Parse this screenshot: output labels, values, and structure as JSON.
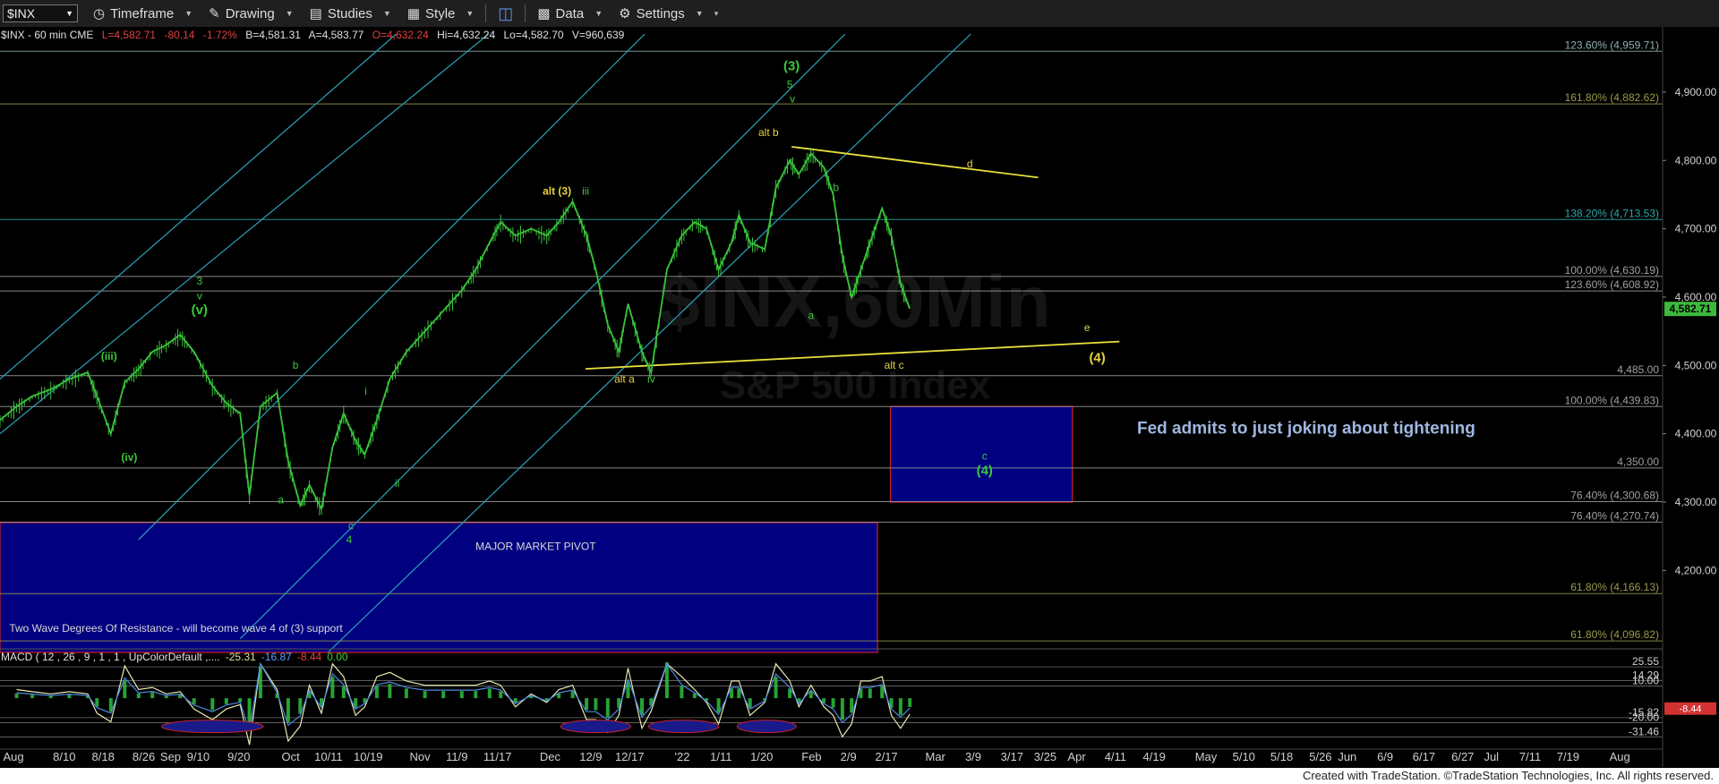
{
  "toolbar": {
    "symbol": "$INX",
    "timeframe": "Timeframe",
    "drawing": "Drawing",
    "studies": "Studies",
    "style": "Style",
    "data": "Data",
    "settings": "Settings"
  },
  "header": {
    "info": "$INX - 60 min  CME",
    "last": "L=4,582.71",
    "change": "-80.14",
    "pct": "-1.72%",
    "bid": "B=4,581.31",
    "ask": "A=4,583.77",
    "open": "O=4,632.24",
    "high": "Hi=4,632.24",
    "low": "Lo=4,582.70",
    "volume": "V=960,639"
  },
  "watermark": {
    "symbol": "$INX,60Min",
    "name": "S&P 500 Index"
  },
  "chart_data": {
    "type": "line",
    "title": "$INX - 60 min",
    "ylim": [
      4080,
      4985
    ],
    "price_ticks": [
      4200,
      4300,
      4400,
      4500,
      4600,
      4700,
      4800,
      4900
    ],
    "price_tick_labels": [
      "4,200.00",
      "4,300.00",
      "4,400.00",
      "4,500.00",
      "4,600.00",
      "4,700.00",
      "4,800.00",
      "4,900.00"
    ],
    "last_price": {
      "value": 4582.71,
      "label": "4,582.71",
      "color": "#3cb93c"
    },
    "x_ticks": [
      {
        "t": 0.03,
        "label": "Aug"
      },
      {
        "t": 0.58,
        "label": "8/10"
      },
      {
        "t": 1.0,
        "label": "8/18"
      },
      {
        "t": 1.44,
        "label": "8/26"
      },
      {
        "t": 1.73,
        "label": "Sep"
      },
      {
        "t": 2.03,
        "label": "9/10"
      },
      {
        "t": 2.47,
        "label": "9/20"
      },
      {
        "t": 3.03,
        "label": "Oct"
      },
      {
        "t": 3.44,
        "label": "10/11"
      },
      {
        "t": 3.87,
        "label": "10/19"
      },
      {
        "t": 4.43,
        "label": "Nov"
      },
      {
        "t": 4.83,
        "label": "11/9"
      },
      {
        "t": 5.27,
        "label": "11/17"
      },
      {
        "t": 5.84,
        "label": "Dec"
      },
      {
        "t": 6.28,
        "label": "12/9"
      },
      {
        "t": 6.7,
        "label": "12/17"
      },
      {
        "t": 7.27,
        "label": "'22"
      },
      {
        "t": 7.69,
        "label": "1/11"
      },
      {
        "t": 8.13,
        "label": "1/20"
      },
      {
        "t": 8.67,
        "label": "Feb"
      },
      {
        "t": 9.07,
        "label": "2/9"
      },
      {
        "t": 9.48,
        "label": "2/17"
      },
      {
        "t": 10.01,
        "label": "Mar"
      },
      {
        "t": 10.42,
        "label": "3/9"
      },
      {
        "t": 10.84,
        "label": "3/17"
      },
      {
        "t": 11.2,
        "label": "3/25"
      },
      {
        "t": 11.54,
        "label": "Apr"
      },
      {
        "t": 11.96,
        "label": "4/11"
      },
      {
        "t": 12.38,
        "label": "4/19"
      },
      {
        "t": 12.94,
        "label": "May"
      },
      {
        "t": 13.35,
        "label": "5/10"
      },
      {
        "t": 13.76,
        "label": "5/18"
      },
      {
        "t": 14.18,
        "label": "5/26"
      },
      {
        "t": 14.47,
        "label": "Jun"
      },
      {
        "t": 14.88,
        "label": "6/9"
      },
      {
        "t": 15.3,
        "label": "6/17"
      },
      {
        "t": 15.72,
        "label": "6/27"
      },
      {
        "t": 16.03,
        "label": "Jul"
      },
      {
        "t": 16.45,
        "label": "7/11"
      },
      {
        "t": 16.86,
        "label": "7/19"
      },
      {
        "t": 17.42,
        "label": "Aug"
      }
    ],
    "price_series": {
      "color": "#39c43a",
      "points": [
        [
          0.0,
          4420
        ],
        [
          0.18,
          4440
        ],
        [
          0.35,
          4455
        ],
        [
          0.55,
          4465
        ],
        [
          0.75,
          4480
        ],
        [
          0.95,
          4490
        ],
        [
          1.05,
          4455
        ],
        [
          1.2,
          4400
        ],
        [
          1.35,
          4475
        ],
        [
          1.5,
          4495
        ],
        [
          1.65,
          4520
        ],
        [
          1.8,
          4530
        ],
        [
          1.95,
          4545
        ],
        [
          2.1,
          4520
        ],
        [
          2.3,
          4470
        ],
        [
          2.45,
          4445
        ],
        [
          2.6,
          4430
        ],
        [
          2.7,
          4310
        ],
        [
          2.82,
          4440
        ],
        [
          3.0,
          4460
        ],
        [
          3.12,
          4360
        ],
        [
          3.25,
          4295
        ],
        [
          3.35,
          4325
        ],
        [
          3.48,
          4290
        ],
        [
          3.6,
          4380
        ],
        [
          3.72,
          4430
        ],
        [
          3.85,
          4390
        ],
        [
          3.95,
          4370
        ],
        [
          4.08,
          4420
        ],
        [
          4.22,
          4480
        ],
        [
          4.4,
          4520
        ],
        [
          4.6,
          4550
        ],
        [
          4.8,
          4580
        ],
        [
          5.0,
          4610
        ],
        [
          5.15,
          4640
        ],
        [
          5.3,
          4680
        ],
        [
          5.42,
          4710
        ],
        [
          5.58,
          4690
        ],
        [
          5.75,
          4700
        ],
        [
          5.92,
          4690
        ],
        [
          6.05,
          4710
        ],
        [
          6.2,
          4740
        ],
        [
          6.35,
          4690
        ],
        [
          6.45,
          4640
        ],
        [
          6.58,
          4560
        ],
        [
          6.7,
          4520
        ],
        [
          6.8,
          4590
        ],
        [
          6.95,
          4520
        ],
        [
          7.05,
          4490
        ],
        [
          7.22,
          4640
        ],
        [
          7.38,
          4690
        ],
        [
          7.52,
          4710
        ],
        [
          7.65,
          4700
        ],
        [
          7.78,
          4640
        ],
        [
          7.92,
          4680
        ],
        [
          8.0,
          4720
        ],
        [
          8.12,
          4680
        ],
        [
          8.28,
          4670
        ],
        [
          8.4,
          4760
        ],
        [
          8.55,
          4800
        ],
        [
          8.65,
          4780
        ],
        [
          8.78,
          4810
        ],
        [
          8.92,
          4790
        ],
        [
          9.02,
          4750
        ],
        [
          9.12,
          4660
        ],
        [
          9.22,
          4600
        ],
        [
          9.32,
          4640
        ],
        [
          9.42,
          4680
        ],
        [
          9.55,
          4730
        ],
        [
          9.65,
          4690
        ],
        [
          9.75,
          4620
        ],
        [
          9.85,
          4583
        ]
      ]
    },
    "horizontal_levels": [
      {
        "price": 4959.71,
        "label": "123.60% (4,959.71)",
        "color": "#8fb0b0"
      },
      {
        "price": 4882.62,
        "label": "161.80% (4,882.62)",
        "color": "#9a9a4a"
      },
      {
        "price": 4713.53,
        "label": "138.20% (4,713.53)",
        "color": "#2aa8a8"
      },
      {
        "price": 4630.19,
        "label": "100.00% (4,630.19)",
        "color": "#a0a0a0"
      },
      {
        "price": 4608.92,
        "label": "123.60% (4,608.92)",
        "color": "#a0a0a0"
      },
      {
        "price": 4485.0,
        "label": "4,485.00",
        "color": "#a0a0a0"
      },
      {
        "price": 4439.83,
        "label": "100.00% (4,439.83)",
        "color": "#a0a0a0"
      },
      {
        "price": 4350.0,
        "label": "4,350.00",
        "color": "#a0a0a0"
      },
      {
        "price": 4300.68,
        "label": "76.40% (4,300.68)",
        "color": "#a0a0a0"
      },
      {
        "price": 4270.74,
        "label": "76.40% (4,270.74)",
        "color": "#a0a0a0"
      },
      {
        "price": 4166.13,
        "label": "61.80% (4,166.13)",
        "color": "#9a9a4a"
      },
      {
        "price": 4096.82,
        "label": "61.80% (4,096.82)",
        "color": "#9a9a4a"
      }
    ],
    "trend_channels": [
      {
        "t1": 0.0,
        "p1": 4480,
        "t2": 4.29,
        "p2": 4985
      },
      {
        "t1": 0.0,
        "p1": 4400,
        "t2": 5.29,
        "p2": 4985
      },
      {
        "t1": 1.5,
        "p1": 4245,
        "t2": 6.98,
        "p2": 4985
      },
      {
        "t1": 2.6,
        "p1": 4100,
        "t2": 9.15,
        "p2": 4985
      },
      {
        "t1": 3.55,
        "p1": 4080,
        "t2": 10.51,
        "p2": 4985
      }
    ],
    "triangle_lines": [
      {
        "t1": 8.57,
        "p1": 4820,
        "t2": 11.24,
        "p2": 4775
      },
      {
        "t1": 6.34,
        "p1": 4495,
        "t2": 12.12,
        "p2": 4535
      }
    ],
    "zones": [
      {
        "t1": 9.64,
        "t2": 11.61,
        "p_top": 4440,
        "p_bottom": 4300,
        "fill": "#000080",
        "stroke": "#cc2222"
      },
      {
        "t1": 0.0,
        "t2": 9.5,
        "p_top": 4270,
        "p_bottom": 4080,
        "fill": "#000080",
        "stroke": "#cc2222"
      }
    ],
    "wave_labels": [
      {
        "t": 8.57,
        "p": 4932,
        "text": "(3)",
        "color": "#3cc83c"
      },
      {
        "t": 8.55,
        "p": 4906,
        "text": "5",
        "color": "#3cc83c"
      },
      {
        "t": 8.58,
        "p": 4885,
        "text": "v",
        "color": "#3cc83c"
      },
      {
        "t": 8.32,
        "p": 4836,
        "text": "alt b",
        "color": "#e6d23c"
      },
      {
        "t": 6.03,
        "p": 4750,
        "text": "alt (3)",
        "color": "#e6d23c"
      },
      {
        "t": 6.34,
        "p": 4750,
        "text": "iii",
        "color": "#3cc83c"
      },
      {
        "t": 10.5,
        "p": 4790,
        "text": "d",
        "color": "#e6d23c"
      },
      {
        "t": 9.05,
        "p": 4755,
        "text": "b",
        "color": "#3cc83c"
      },
      {
        "t": 8.78,
        "p": 4568,
        "text": "a",
        "color": "#3cc83c"
      },
      {
        "t": 11.77,
        "p": 4550,
        "text": "e",
        "color": "#e6d23c"
      },
      {
        "t": 11.88,
        "p": 4505,
        "text": "(4)",
        "color": "#e6d23c"
      },
      {
        "t": 9.68,
        "p": 4495,
        "text": "alt c",
        "color": "#e6d23c"
      },
      {
        "t": 6.76,
        "p": 4475,
        "text": "alt a",
        "color": "#e6d23c"
      },
      {
        "t": 7.05,
        "p": 4475,
        "text": "iv",
        "color": "#3cc83c"
      },
      {
        "t": 10.66,
        "p": 4362,
        "text": "c",
        "color": "#3cc83c"
      },
      {
        "t": 10.66,
        "p": 4340,
        "text": "(4)",
        "color": "#3cc83c"
      },
      {
        "t": 2.16,
        "p": 4618,
        "text": "3",
        "color": "#3cc83c"
      },
      {
        "t": 2.16,
        "p": 4597,
        "text": "v",
        "color": "#3cc83c"
      },
      {
        "t": 2.16,
        "p": 4575,
        "text": "(v)",
        "color": "#3cc83c"
      },
      {
        "t": 1.18,
        "p": 4508,
        "text": "(iii)",
        "color": "#3cc83c"
      },
      {
        "t": 3.2,
        "p": 4495,
        "text": "b",
        "color": "#3cc83c"
      },
      {
        "t": 1.4,
        "p": 4360,
        "text": "(iv)",
        "color": "#3cc83c"
      },
      {
        "t": 3.96,
        "p": 4457,
        "text": "i",
        "color": "#3cc83c"
      },
      {
        "t": 4.3,
        "p": 4322,
        "text": "ii",
        "color": "#3cc83c"
      },
      {
        "t": 3.04,
        "p": 4298,
        "text": "a",
        "color": "#3cc83c"
      },
      {
        "t": 3.8,
        "p": 4260,
        "text": "c",
        "color": "#3cc83c"
      },
      {
        "t": 3.78,
        "p": 4240,
        "text": "4",
        "color": "#3cc83c"
      }
    ],
    "annotations": [
      {
        "t": 12.31,
        "p": 4400,
        "text": "Fed admits to just joking about tightening",
        "color": "#9fb7e0"
      },
      {
        "t": 5.8,
        "p": 4230,
        "text": "MAJOR MARKET PIVOT",
        "color": "#d8d8d8"
      },
      {
        "t": 0.1,
        "p": 4110,
        "text": "Two Wave Degrees Of Resistance - will become wave 4 of (3) support",
        "color": "#d8d8d8"
      }
    ]
  },
  "macd": {
    "title": "MACD ( 12 , 26 , 9 , 1 , 1 , UpColorDefault ,....",
    "value1": "-25.31",
    "value2": "-16.87",
    "value3": "-8.44",
    "value4": "0.00",
    "ylim": [
      -40,
      30
    ],
    "tick_values": [
      25.55,
      14.29,
      10.0,
      -15.82,
      -20.0,
      -31.46
    ],
    "tick_labels": [
      "25.55",
      "14.29",
      "10.00",
      "-15.82",
      "-20.00",
      "-31.46"
    ],
    "current_label": "-8.44",
    "current_color": "#d23232"
  },
  "footer": {
    "text": "Created with TradeStation. ©TradeStation Technologies, Inc. All rights reserved."
  }
}
